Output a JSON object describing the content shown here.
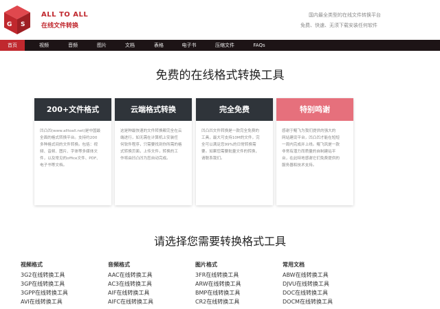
{
  "header": {
    "brand_en": "ALL TO ALL",
    "brand_cn": "在线文件转换",
    "tagline1": "国内最全类型的在线文件转换平台",
    "tagline2": "免费、快速、无须下载安装任何软件"
  },
  "nav": [
    "首页",
    "视频",
    "音频",
    "图片",
    "文档",
    "表格",
    "电子书",
    "压缩文件",
    "FAQs"
  ],
  "hero_title": "免费的在线格式转换工具",
  "cards": [
    {
      "title": "200+文件格式",
      "lines": [
        "凹凸凹(www.alltoall.net)是中国最",
        "全面的格式转换平台。支持约200",
        "多种格式间的文件转换。包括：视",
        "频、音频、图片、字体等多媒体文",
        "件，以及常见的office文件、PDF、",
        "电子书等文档。"
      ]
    },
    {
      "title": "云端格式转换",
      "lines": [
        "这是种最快速的文件转换都完全在云",
        "端进行，如无需在计算机上安装任",
        "何软件程序，只需要找到你所需的格",
        "式转换页面，上传文件，转换的工",
        "作将由凹凸凹为您自动完成。"
      ]
    },
    {
      "title": "完全免费",
      "lines": [
        "凹凸凹文件转换是一款完全免费的",
        "工具，最大可支持10M的文件，完",
        "全可以满足您99%的日常转换需",
        "要。如果您需要批量文件的转换，",
        "请联系我们。"
      ]
    },
    {
      "title": "特别鸣谢",
      "lines": [
        "感谢于鲲飞为我们提供的强大的",
        "网站建设平台，凹凸凹才能在短短",
        "一周内完成并上线。鲲飞凤是一款",
        "非常有潜力而质量的自制建站平",
        "台，在此特地感谢它们免费提供的",
        "服务器和技术支持。"
      ]
    }
  ],
  "formats_title": "请选择您需要转换格式工具",
  "columns": [
    {
      "heading": "视频格式",
      "links": [
        "3G2在线转换工具",
        "3GP在线转换工具",
        "3GPP在线转换工具",
        "AVI在线转换工具"
      ]
    },
    {
      "heading": "音频格式",
      "links": [
        "AAC在线转换工具",
        "AC3在线转换工具",
        "AIF在线转换工具",
        "AIFC在线转换工具"
      ]
    },
    {
      "heading": "图片格式",
      "links": [
        "3FR在线转换工具",
        "ARW在线转换工具",
        "BMP在线转换工具",
        "CR2在线转换工具"
      ]
    },
    {
      "heading": "常用文档",
      "links": [
        "ABW在线转换工具",
        "DJVU在线转换工具",
        "DOC在线转换工具",
        "DOCM在线转换工具"
      ]
    }
  ],
  "colors": {
    "brand": "#c0282e",
    "nav_bg": "#1d1416",
    "card_head": "#2f343a",
    "card_pink": "#e6707c"
  }
}
